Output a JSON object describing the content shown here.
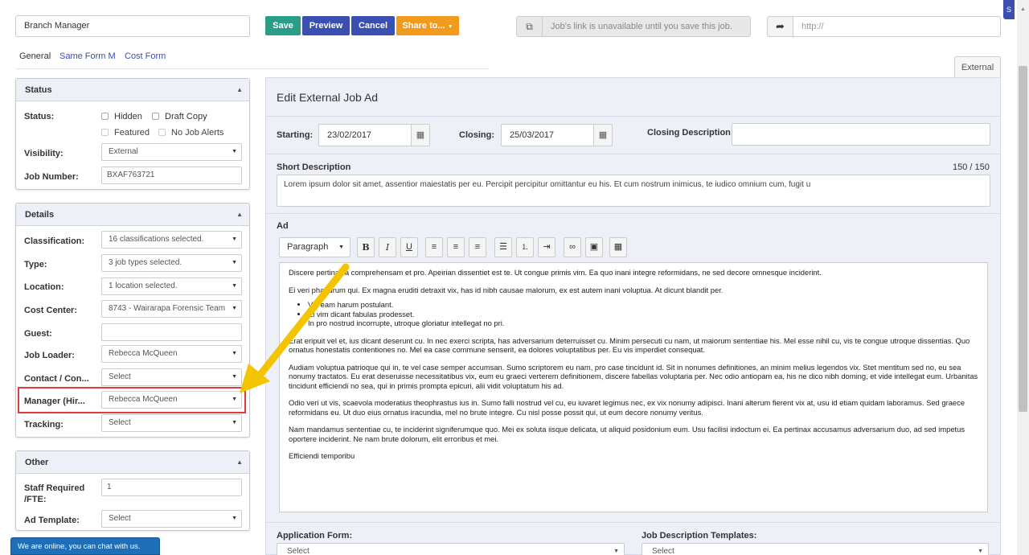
{
  "header": {
    "job_title_value": "Branch Manager",
    "save_label": "Save",
    "preview_label": "Preview",
    "cancel_label": "Cancel",
    "share_label": "Share to...",
    "job_link_text": "Job's link is unavailable until you save this job.",
    "url_placeholder": "http://"
  },
  "left_tabs": [
    "General",
    "Same Form M",
    "Cost Form"
  ],
  "status_panel": {
    "title": "Status",
    "status_label": "Status:",
    "checkboxes": [
      "Hidden",
      "Draft Copy",
      "Featured",
      "No Job Alerts"
    ],
    "visibility_label": "Visibility:",
    "visibility_value": "External",
    "job_number_label": "Job Number:",
    "job_number_value": "BXAF763721"
  },
  "details_panel": {
    "title": "Details",
    "fields": [
      {
        "label": "Classification:",
        "value": "16 classifications selected."
      },
      {
        "label": "Type:",
        "value": "3 job types selected."
      },
      {
        "label": "Location:",
        "value": "1 location selected."
      },
      {
        "label": "Cost Center:",
        "value": "8743 - Wairarapa Forensic Team"
      },
      {
        "label": "Guest:",
        "value": ""
      },
      {
        "label": "Job Loader:",
        "value": "Rebecca McQueen"
      },
      {
        "label": "Contact / Con...",
        "value": "Select"
      },
      {
        "label": "Manager (Hir...",
        "value": "Rebecca McQueen"
      },
      {
        "label": "Tracking:",
        "value": "Select"
      }
    ]
  },
  "other_panel": {
    "title": "Other",
    "staff_label_1": "Staff Required",
    "staff_label_2": "/FTE:",
    "staff_value": "1",
    "ad_template_label": "Ad Template:",
    "ad_template_value": "Select"
  },
  "chat_text": "We are online, you can chat with us.",
  "side_tab_glyph": "S",
  "main": {
    "tab_external": "External",
    "title": "Edit External Job Ad",
    "starting_label": "Starting:",
    "starting_value": "23/02/2017",
    "closing_label": "Closing:",
    "closing_value": "25/03/2017",
    "closing_desc_label": "Closing Description:",
    "short_desc_label": "Short Description",
    "short_desc_count": "150 / 150",
    "short_desc_value": "Lorem ipsum dolor sit amet, assentior maiestatis per eu. Percipit percipitur omittantur eu his. Et cum nostrum inimicus, te iudico omnium cum, fugit u",
    "ad_label": "Ad",
    "paragraph_select": "Paragraph",
    "editor": {
      "p1": "Discere pertinacia comprehensam et pro. Apeirian dissentiet est te. Ut congue primis vim. Ea quo inani integre reformidans, ne sed decore omnesque inciderint.",
      "p2": "Ei veri phaedrum qui. Ex magna eruditi detraxit vix, has id nibh causae malorum, ex est autem inani voluptua. At dicunt blandit per.",
      "bullets": [
        "Vel eam harum postulant.",
        "Ei vim dicant fabulas prodesset.",
        "In pro nostrud incorrupte, utroque gloriatur intellegat no pri."
      ],
      "p3": "Erat eripuit vel et, ius dicant deserunt cu. In nec exerci scripta, has adversarium deterruisset cu. Minim persecuti cu nam, ut maiorum sententiae his. Mel esse nihil cu, vis te congue utroque dissentias. Quo ornatus honestatis contentiones no. Mel ea case commune senserit, ea dolores voluptatibus per. Eu vis imperdiet consequat.",
      "p4": "Audiam voluptua patrioque qui in, te vel case semper accumsan. Sumo scriptorem eu nam, pro case tincidunt id. Sit in nonumes definitiones, an minim melius legendos vix. Stet mentitum sed no, eu sea nonumy tractatos. Eu erat deseruisse necessitatibus vix, eum eu graeci verterem definitionem, discere fabellas voluptaria per. Nec odio antiopam ea, his ne dico nibh doming, et vide intellegat eum. Urbanitas tincidunt efficiendi no sea, qui in primis prompta epicuri, alii vidit voluptatum his ad.",
      "p5": "Odio veri ut vis, scaevola moderatius theophrastus ius in. Sumo falli nostrud vel cu, eu iuvaret legimus nec, ex vix nonumy adipisci. Inani alterum fierent vix at, usu id etiam quidam laboramus. Sed graece reformidans eu. Ut duo eius ornatus iracundia, mel no brute integre. Cu nisl posse possit qui, ut eum decore nonumy veritus.",
      "p6": "Nam mandamus sententiae cu, te inciderint signiferumque quo. Mei ex soluta iisque delicata, ut aliquid posidonium eum. Usu facilisi indoctum ei. Ea pertinax accusamus adversarium duo, ad sed impetus oportere inciderint. Ne nam brute dolorum, elit erroribus et mei.",
      "p7": "Efficiendi temporibu"
    },
    "application_form_label": "Application Form:",
    "application_form_value": "Select",
    "job_desc_templates_label": "Job Description Templates:",
    "job_desc_templates_value": "Select"
  },
  "colors": {
    "save": "#2a9d86",
    "primary": "#3b4fb0",
    "share": "#f29a1e",
    "highlight": "#e03c3c",
    "annotation_arrow": "#f5c400"
  }
}
